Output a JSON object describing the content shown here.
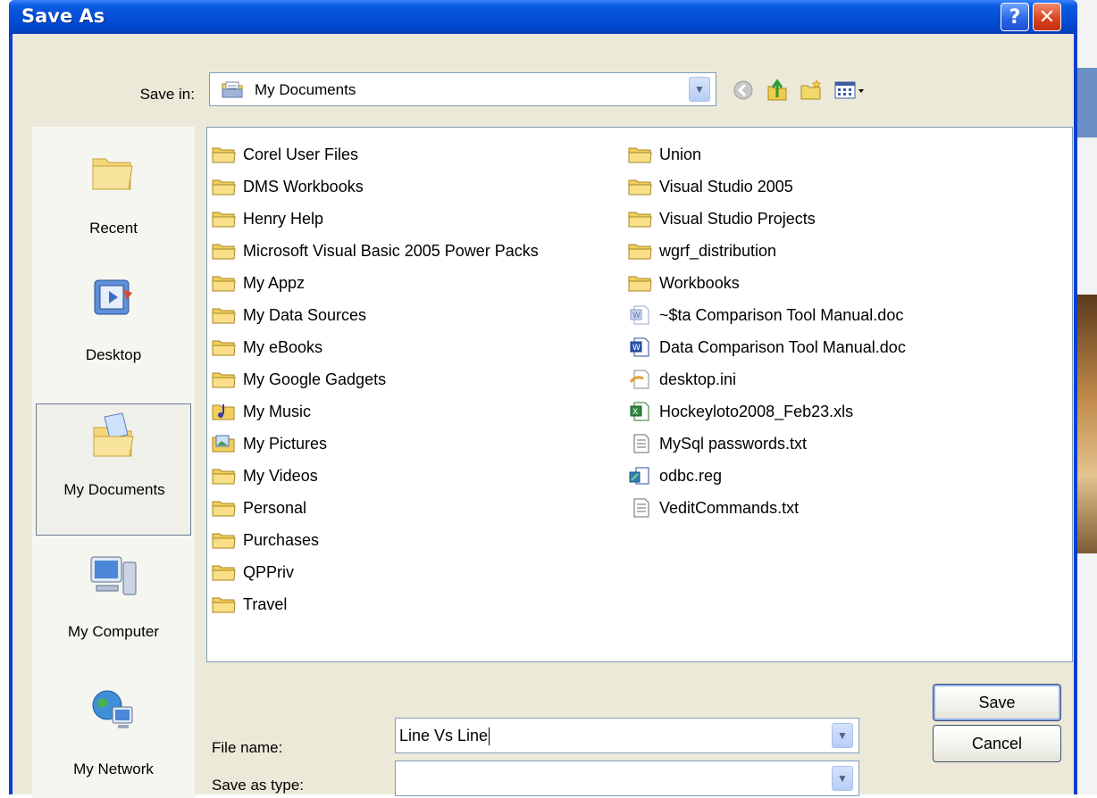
{
  "dialog": {
    "title": "Save As",
    "help_glyph": "?",
    "close_glyph": "✕"
  },
  "toolbar": {
    "save_in_label": "Save in:",
    "save_in_value": "My Documents",
    "icons": [
      "back-icon",
      "up-folder-icon",
      "new-folder-icon",
      "views-menu-icon"
    ]
  },
  "places": [
    {
      "label": "Recent",
      "icon": "recent-folder-icon"
    },
    {
      "label": "Desktop",
      "icon": "desktop-icon"
    },
    {
      "label": "My Documents",
      "icon": "my-documents-icon",
      "selected": true
    },
    {
      "label": "My Computer",
      "icon": "my-computer-icon"
    },
    {
      "label": "My Network",
      "icon": "my-network-icon"
    }
  ],
  "files": {
    "column1": [
      {
        "name": "Corel User Files",
        "icon": "folder"
      },
      {
        "name": "DMS Workbooks",
        "icon": "folder"
      },
      {
        "name": "Henry Help",
        "icon": "folder"
      },
      {
        "name": "Microsoft Visual Basic 2005 Power Packs",
        "icon": "folder"
      },
      {
        "name": "My Appz",
        "icon": "folder"
      },
      {
        "name": "My Data Sources",
        "icon": "folder"
      },
      {
        "name": "My eBooks",
        "icon": "folder"
      },
      {
        "name": "My Google Gadgets",
        "icon": "folder"
      },
      {
        "name": "My Music",
        "icon": "music-folder"
      },
      {
        "name": "My Pictures",
        "icon": "pictures-folder"
      },
      {
        "name": "My Videos",
        "icon": "folder"
      },
      {
        "name": "Personal",
        "icon": "folder"
      },
      {
        "name": "Purchases",
        "icon": "folder"
      },
      {
        "name": "QPPriv",
        "icon": "folder"
      },
      {
        "name": "Travel",
        "icon": "folder"
      }
    ],
    "column2": [
      {
        "name": "Union",
        "icon": "folder"
      },
      {
        "name": "Visual Studio 2005",
        "icon": "folder"
      },
      {
        "name": "Visual Studio Projects",
        "icon": "folder"
      },
      {
        "name": "wgrf_distribution",
        "icon": "folder"
      },
      {
        "name": "Workbooks",
        "icon": "folder"
      },
      {
        "name": "~$ta Comparison Tool Manual.doc",
        "icon": "word-doc-faded"
      },
      {
        "name": "Data Comparison Tool Manual.doc",
        "icon": "word-doc"
      },
      {
        "name": "desktop.ini",
        "icon": "ini-file"
      },
      {
        "name": "Hockeyloto2008_Feb23.xls",
        "icon": "excel-file"
      },
      {
        "name": "MySql passwords.txt",
        "icon": "text-file"
      },
      {
        "name": "odbc.reg",
        "icon": "reg-file"
      },
      {
        "name": "VeditCommands.txt",
        "icon": "text-file"
      }
    ]
  },
  "form": {
    "file_name_label": "File name:",
    "file_name_value": "Line Vs Line",
    "save_as_type_label": "Save as type:",
    "save_as_type_value": ""
  },
  "buttons": {
    "save": "Save",
    "cancel": "Cancel"
  }
}
